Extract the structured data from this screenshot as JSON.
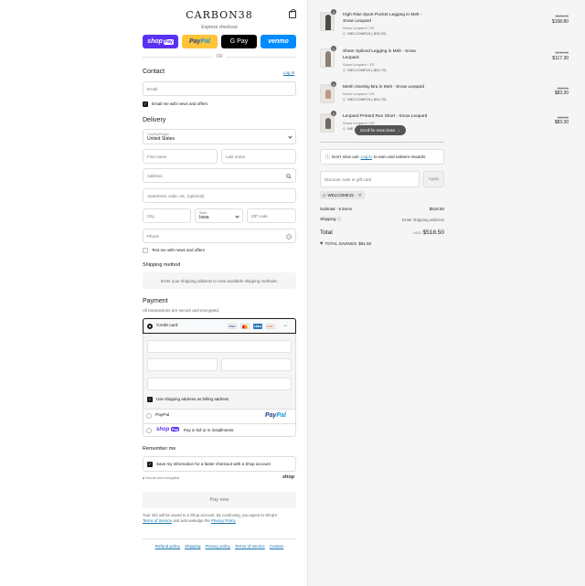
{
  "brand": {
    "logo": "CARBON38"
  },
  "express": {
    "title": "Express checkout",
    "shoppay": "shop",
    "shoppay_pill": "Pay",
    "paypal_a": "Pay",
    "paypal_b": "Pal",
    "gpay": "G Pay",
    "venmo": "venmo"
  },
  "or_text": "OR",
  "contact": {
    "heading": "Contact",
    "login": "Log in",
    "email_placeholder": "Email",
    "email_news": "Email me with news and offers"
  },
  "delivery": {
    "heading": "Delivery",
    "country_label": "Country/Region",
    "country_value": "United States",
    "first_name": "First name",
    "last_name": "Last name",
    "address": "Address",
    "apartment": "Apartment, suite, etc. (optional)",
    "city": "City",
    "state_label": "State",
    "state_value": "Iowa",
    "zip": "ZIP code",
    "phone": "Phone",
    "text_news": "Text me with news and offers"
  },
  "shipping_method": {
    "heading": "Shipping method",
    "info": "Enter your shipping address to view available shipping methods."
  },
  "payment": {
    "heading": "Payment",
    "sub": "All transactions are secure and encrypted.",
    "credit_card": "Credit card",
    "card_logos": [
      "VISA",
      "MC",
      "AMEX",
      "DISC"
    ],
    "billing_same": "Use shipping address as billing address",
    "paypal": "PayPal",
    "shoppay_text": "Pay in full or in installments",
    "shoppay_logo": "shop",
    "shoppay_pill": "Pay"
  },
  "remember": {
    "heading": "Remember me",
    "save_info": "Save my information for a faster checkout with a Shop account",
    "secure": "Secure and encrypted",
    "shop_logo": "shop"
  },
  "pay_now": "Pay now",
  "legal": {
    "text1": "Your info will be saved to a Shop account. By continuing, you agree to Shop's",
    "terms": "Terms of Service",
    "and": "and acknowledge the",
    "privacy": "Privacy Policy"
  },
  "footer": [
    "Refund policy",
    "Shipping",
    "Privacy policy",
    "Terms of service",
    "Contact"
  ],
  "cart": {
    "items": [
      {
        "qty": "1",
        "name_1": "High Rise Sport Pocket Legging in Melt -",
        "name_2": "Snow Leopard",
        "variant": "Snow Leopard / XS",
        "discount": "WELCOME15 (-$19.20)",
        "original": "$128.00",
        "price": "$108.80",
        "color": "#4a4a4a"
      },
      {
        "qty": "1",
        "name_1": "Sheer Spliced Legging in Melt - Snow",
        "name_2": "Leopard",
        "variant": "Snow Leopard / XS",
        "discount": "WELCOME15 (-$20.70)",
        "original": "$138.00",
        "price": "$117.30",
        "color": "#8a8078"
      },
      {
        "qty": "1",
        "name_1": "Mesh Overlay Bra in Melt - Snow Leopard",
        "name_2": "",
        "variant": "Snow Leopard / XS",
        "discount": "WELCOME15 (-$14.70)",
        "original": "$98.00",
        "price": "$83.30",
        "color": "#b89a85"
      },
      {
        "qty": "1",
        "name_1": "Leopard Printed Run Short - Snow Leopard",
        "name_2": "",
        "variant": "Snow Leopard / XS",
        "discount": "WE",
        "original": "$98.00",
        "price": "$83.30",
        "color": "#6f6a66"
      }
    ],
    "scroll_more": "Scroll for more items",
    "rewards_a": "Don't miss out!",
    "rewards_link": "Log in",
    "rewards_b": "to earn and redeem rewards",
    "discount_placeholder": "Discount code or gift card",
    "apply": "Apply",
    "applied_code": "WELCOME15",
    "subtotal_label": "Subtotal · 5 items",
    "subtotal_value": "$518.50",
    "shipping_label": "Shipping",
    "shipping_value": "Enter shipping address",
    "total_label": "Total",
    "currency": "USD",
    "total_value": "$518.50",
    "savings_label": "TOTAL SAVINGS",
    "savings_value": "$91.50"
  },
  "colors": {
    "shoppay": "#5a31f4",
    "paypal": "#ffc439",
    "venmo": "#008cff",
    "link": "#1773b0"
  }
}
